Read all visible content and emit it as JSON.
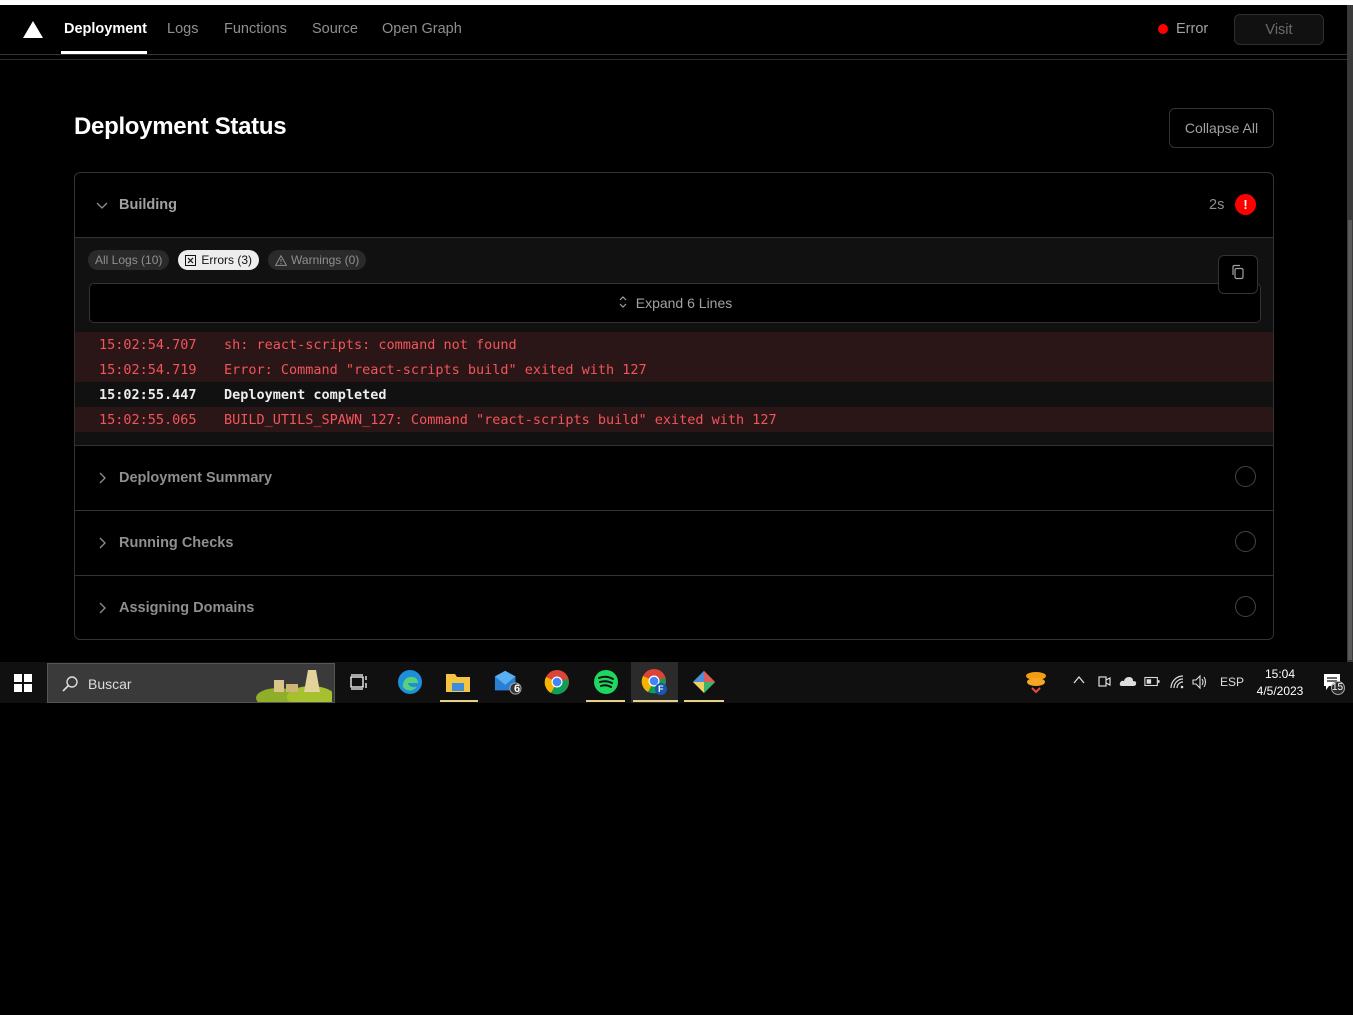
{
  "nav": {
    "tabs": [
      {
        "label": "Deployment",
        "active": true
      },
      {
        "label": "Logs",
        "active": false
      },
      {
        "label": "Functions",
        "active": false
      },
      {
        "label": "Source",
        "active": false
      },
      {
        "label": "Open Graph",
        "active": false
      }
    ],
    "status_label": "Error",
    "status_color": "#ff0000",
    "visit_label": "Visit"
  },
  "header": {
    "title": "Deployment Status",
    "collapse_label": "Collapse All"
  },
  "building": {
    "label": "Building",
    "duration": "2s",
    "status_icon": "error-icon",
    "filters": [
      {
        "label": "All Logs (10)",
        "icon": "",
        "active": false
      },
      {
        "label": "Errors (3)",
        "icon": "error-box-icon",
        "active": true
      },
      {
        "label": "Warnings (0)",
        "icon": "warning-icon",
        "active": false
      }
    ],
    "expand_label": "Expand 6 Lines",
    "logs": [
      {
        "time": "15:02:54.707",
        "message": "sh: react-scripts: command not found",
        "level": "error"
      },
      {
        "time": "15:02:54.719",
        "message": "Error: Command \"react-scripts build\" exited with 127",
        "level": "error"
      },
      {
        "time": "15:02:55.447",
        "message": "Deployment completed",
        "level": "info"
      },
      {
        "time": "15:02:55.065",
        "message": "BUILD_UTILS_SPAWN_127: Command \"react-scripts build\" exited with 127",
        "level": "error"
      }
    ]
  },
  "sections": [
    {
      "label": "Deployment Summary",
      "status": "pending"
    },
    {
      "label": "Running Checks",
      "status": "pending"
    },
    {
      "label": "Assigning Domains",
      "status": "pending"
    }
  ],
  "taskbar": {
    "search_placeholder": "Buscar",
    "mail_badge": "6",
    "chrome_profile_badge": "F",
    "language": "ESP",
    "time": "15:04",
    "date": "4/5/2023",
    "notification_count": "15"
  }
}
